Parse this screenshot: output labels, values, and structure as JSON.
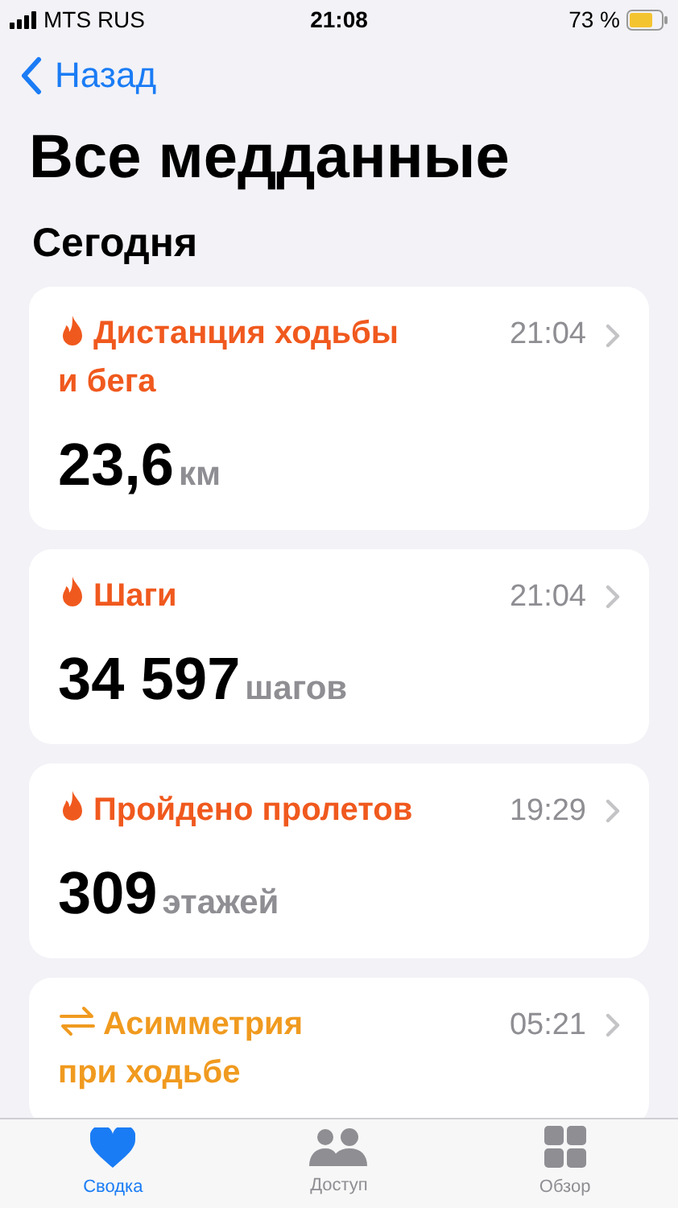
{
  "status_bar": {
    "carrier": "MTS RUS",
    "time": "21:08",
    "battery": "73 %"
  },
  "nav": {
    "back": "Назад"
  },
  "title": "Все медданные",
  "section": "Сегодня",
  "cards": [
    {
      "kind": "flame",
      "color": "#f0591e",
      "title": "Дистанция ходьбы\nи бега",
      "time": "21:04",
      "value": "23,6",
      "unit": "км"
    },
    {
      "kind": "flame",
      "color": "#f0591e",
      "title": "Шаги",
      "time": "21:04",
      "value": "34 597",
      "unit": "шагов"
    },
    {
      "kind": "flame",
      "color": "#f0591e",
      "title": "Пройдено пролетов",
      "time": "19:29",
      "value": "309",
      "unit": "этажей"
    },
    {
      "kind": "asymmetry",
      "color": "#f09a1f",
      "title": "Асимметрия\nпри ходьбе",
      "time": "05:21"
    }
  ],
  "tabs": [
    {
      "kind": "heart",
      "label": "Сводка",
      "selected": true
    },
    {
      "kind": "people",
      "label": "Доступ",
      "selected": false
    },
    {
      "kind": "grid",
      "label": "Обзор",
      "selected": false
    }
  ]
}
